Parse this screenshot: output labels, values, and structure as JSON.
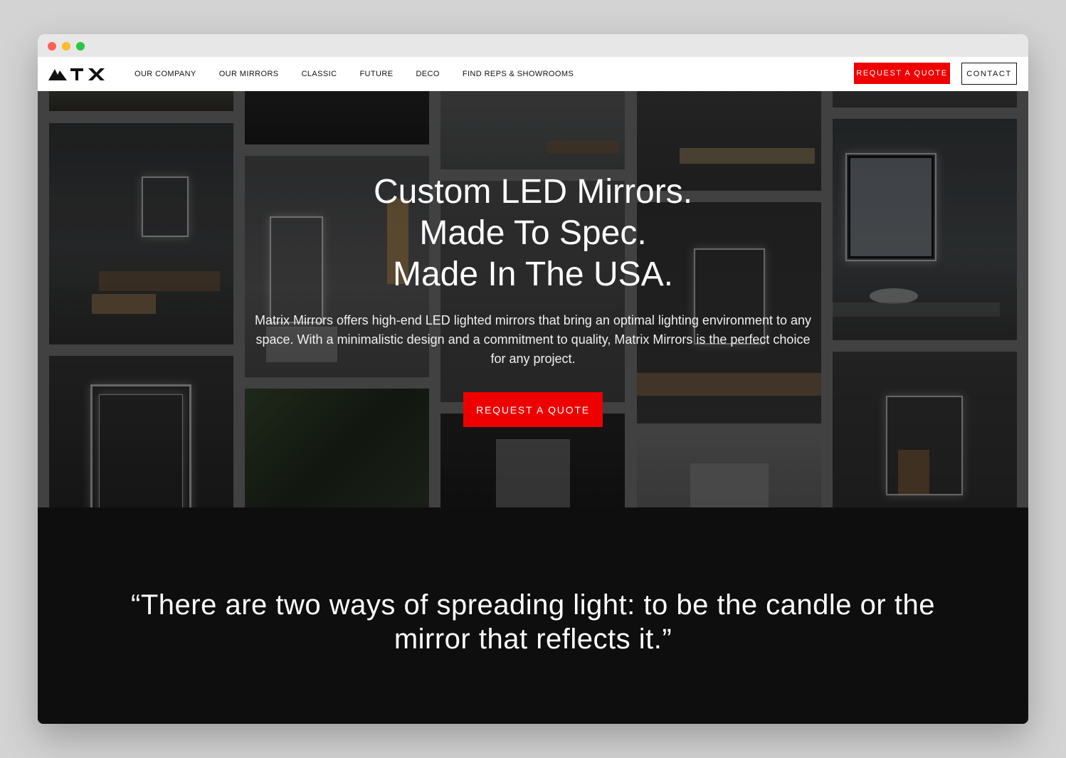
{
  "window": {
    "controls": [
      "close",
      "minimize",
      "maximize"
    ]
  },
  "nav": {
    "logo_icon": "matx-logo",
    "links": [
      "OUR COMPANY",
      "OUR MIRRORS",
      "CLASSIC",
      "FUTURE",
      "DECO",
      "FIND REPS & SHOWROOMS"
    ],
    "quote_button": "REQUEST A QUOTE",
    "contact_button": "CONTACT"
  },
  "hero": {
    "title_lines": [
      "Custom LED Mirrors.",
      "Made To Spec.",
      "Made In The USA."
    ],
    "description": "Matrix Mirrors offers high-end LED lighted mirrors that bring an optimal lighting environment to any space. With a minimalistic design and a commitment to quality, Matrix Mirrors is the perfect choice for any project.",
    "cta": "REQUEST A QUOTE"
  },
  "quote": {
    "text": "“There are two ways of spreading light: to be the candle or the mirror that reflects it.”"
  },
  "colors": {
    "accent": "#ee0000",
    "nav_bg": "#ffffff",
    "quote_bg": "#0e0e0e",
    "hero_gap": "#4a4a4a"
  }
}
